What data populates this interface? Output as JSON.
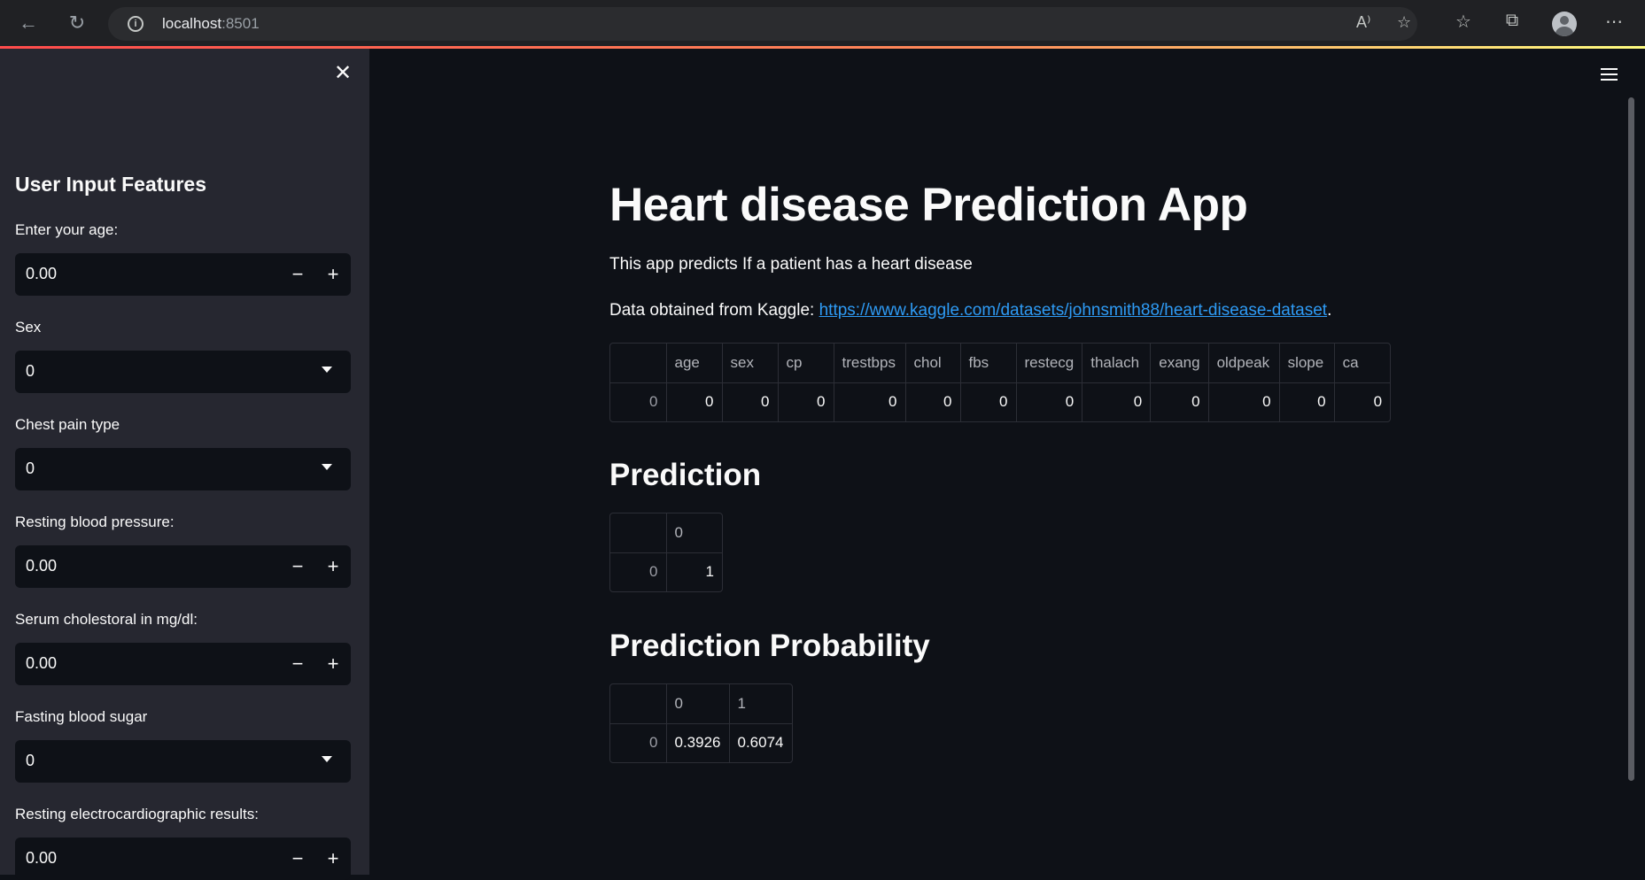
{
  "browser": {
    "url_host": "localhost",
    "url_port": ":8501"
  },
  "sidebar": {
    "title": "User Input Features",
    "fields": [
      {
        "label": "Enter your age:",
        "value": "0.00",
        "type": "number"
      },
      {
        "label": "Sex",
        "value": "0",
        "type": "select"
      },
      {
        "label": "Chest pain type",
        "value": "0",
        "type": "select"
      },
      {
        "label": "Resting blood pressure:",
        "value": "0.00",
        "type": "number"
      },
      {
        "label": "Serum cholestoral in mg/dl:",
        "value": "0.00",
        "type": "number"
      },
      {
        "label": "Fasting blood sugar",
        "value": "0",
        "type": "select"
      },
      {
        "label": "Resting electrocardiographic results:",
        "value": "0.00",
        "type": "number"
      }
    ]
  },
  "main": {
    "title": "Heart disease Prediction App",
    "description": "This app predicts If a patient has a heart disease",
    "data_source_prefix": "Data obtained from Kaggle: ",
    "data_source_link": "https://www.kaggle.com/datasets/johnsmith88/heart-disease-dataset",
    "data_source_suffix": ".",
    "input_table": {
      "columns": [
        "age",
        "sex",
        "cp",
        "trestbps",
        "chol",
        "fbs",
        "restecg",
        "thalach",
        "exang",
        "oldpeak",
        "slope",
        "ca"
      ],
      "rows": [
        {
          "index": "0",
          "values": [
            "0",
            "0",
            "0",
            "0",
            "0",
            "0",
            "0",
            "0",
            "0",
            "0",
            "0",
            "0"
          ]
        }
      ]
    },
    "prediction_heading": "Prediction",
    "prediction_table": {
      "columns": [
        "0"
      ],
      "rows": [
        {
          "index": "0",
          "values": [
            "1"
          ]
        }
      ]
    },
    "probability_heading": "Prediction Probability",
    "probability_table": {
      "columns": [
        "0",
        "1"
      ],
      "rows": [
        {
          "index": "0",
          "values": [
            "0.3926",
            "0.6074"
          ]
        }
      ]
    }
  },
  "colors": {
    "background": "#0e1117",
    "sidebar": "#262730",
    "link": "#2e9bf5",
    "accent_start": "#ff4b4b",
    "accent_end": "#fffd80"
  },
  "icons": [
    "back-arrow-icon",
    "refresh-icon",
    "info-icon",
    "read-aloud-icon",
    "add-favorite-icon",
    "favorites-icon",
    "collections-icon",
    "profile-icon",
    "more-icon",
    "close-icon",
    "hamburger-menu-icon",
    "minus-icon",
    "plus-icon",
    "chevron-down-icon"
  ]
}
